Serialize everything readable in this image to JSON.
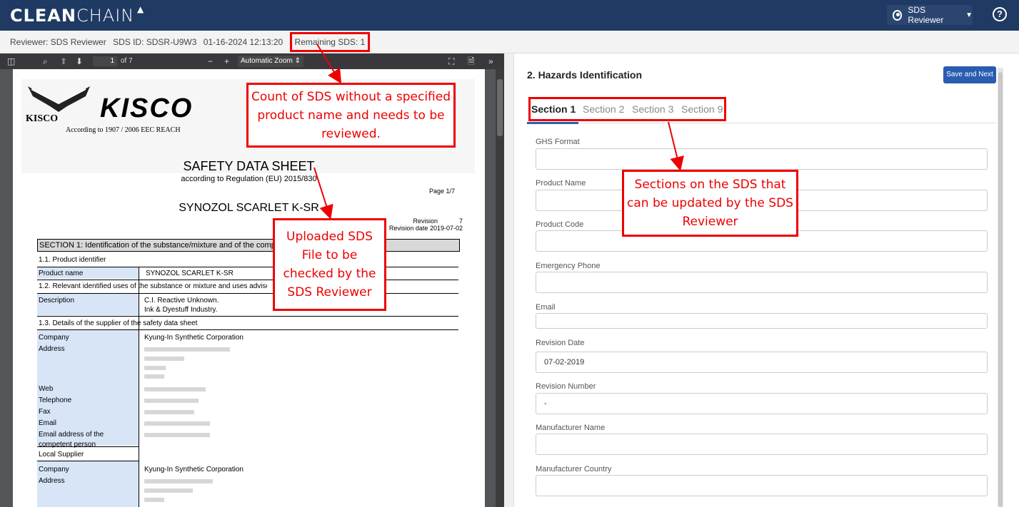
{
  "app": {
    "logo_bold": "CLEAN",
    "logo_light": "CHAIN",
    "logo_mark": "▲",
    "user_label": "SDS Reviewer",
    "help": "?"
  },
  "info": {
    "reviewer": "Reviewer: SDS Reviewer",
    "sds_id": "SDS ID: SDSR-U9W3",
    "timestamp": "01-16-2024 12:13:20",
    "remaining": "Remaining SDS: 1"
  },
  "viewer": {
    "page_input": "1",
    "page_total": "of 7",
    "zoom": "Automatic Zoom",
    "minus": "−",
    "plus": "+",
    "more": "»"
  },
  "pdf": {
    "company_logo": "KISCO",
    "company_small": "KISCO",
    "reach": "According to 1907 / 2006 EEC REACH",
    "title": "SAFETY DATA SHEET",
    "subtitle": "according to Regulation (EU) 2015/830",
    "page_label": "Page   1/7",
    "product": "SYNOZOL SCARLET K-SR",
    "revision_label": "Revision",
    "revision_value": "7",
    "revision_date_label": "Revision date",
    "revision_date": "2019-07-02",
    "section1": "SECTION 1: Identification of the substance/mixture and of the company/undertaking",
    "s11": "1.1. Product identifier",
    "product_name_label": "Product name",
    "product_name_value": "SYNOZOL SCARLET K-SR",
    "s12": "1.2. Relevant identified uses of the substance or mixture and uses advised against",
    "description_label": "Description",
    "description_1": "C.I. Reactive Unknown.",
    "description_2": "Ink & Dyestuff Industry.",
    "s13": "1.3. Details of the supplier of the safety data sheet",
    "company_label": "Company",
    "company_value": "Kyung-In Synthetic Corporation",
    "address_label": "Address",
    "web_label": "Web",
    "telephone_label": "Telephone",
    "fax_label": "Fax",
    "email_label": "Email",
    "competent_label_1": "Email address of the",
    "competent_label_2": "competent person",
    "local_supplier": "Local Supplier",
    "company2_label": "Company",
    "company2_value": "Kyung-In Synthetic Corporation",
    "address2_label": "Address"
  },
  "panel": {
    "title": "2. Hazards Identification",
    "save_button": "Save and Next",
    "tabs": [
      "Section 1",
      "Section 2",
      "Section 3",
      "Section 9"
    ],
    "fields": [
      {
        "label": "GHS Format",
        "value": ""
      },
      {
        "label": "Product Name",
        "value": ""
      },
      {
        "label": "Product Code",
        "value": ""
      },
      {
        "label": "Emergency Phone",
        "value": ""
      },
      {
        "label": "Email",
        "value": ""
      },
      {
        "label": "Revision Date",
        "value": "07-02-2019"
      },
      {
        "label": "Revision Number",
        "value": "-"
      },
      {
        "label": "Manufacturer Name",
        "value": ""
      },
      {
        "label": "Manufacturer Country",
        "value": ""
      }
    ]
  },
  "callouts": {
    "remaining": "Count of SDS without a specified product name and needs to be reviewed.",
    "sections": "Sections on the SDS that can be updated by the SDS Reviewer",
    "uploaded": "Uploaded SDS File to be checked by the SDS Reviewer"
  },
  "colors": {
    "topbar": "#1f3a63",
    "accent": "#2a5db0",
    "annotation": "#e00000"
  }
}
